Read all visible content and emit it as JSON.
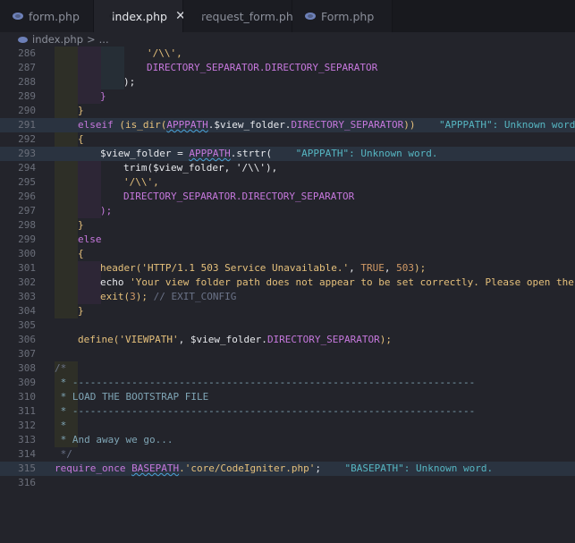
{
  "tabs": [
    {
      "label": "form.php",
      "active": false
    },
    {
      "label": "index.php",
      "active": true
    },
    {
      "label": "request_form.php",
      "active": false
    },
    {
      "label": "Form.php",
      "active": false
    }
  ],
  "close_glyph": "✕",
  "breadcrumb": {
    "file": "index.php",
    "sep": ">",
    "more": "..."
  },
  "lines": [
    {
      "n": "286"
    },
    {
      "n": "287"
    },
    {
      "n": "288"
    },
    {
      "n": "289"
    },
    {
      "n": "290"
    },
    {
      "n": "291"
    },
    {
      "n": "292"
    },
    {
      "n": "293"
    },
    {
      "n": "294"
    },
    {
      "n": "295"
    },
    {
      "n": "296"
    },
    {
      "n": "297"
    },
    {
      "n": "298"
    },
    {
      "n": "299"
    },
    {
      "n": "300"
    },
    {
      "n": "301"
    },
    {
      "n": "302"
    },
    {
      "n": "303"
    },
    {
      "n": "304"
    },
    {
      "n": "305"
    },
    {
      "n": "306"
    },
    {
      "n": "307"
    },
    {
      "n": "308"
    },
    {
      "n": "309"
    },
    {
      "n": "310"
    },
    {
      "n": "311"
    },
    {
      "n": "312"
    },
    {
      "n": "313"
    },
    {
      "n": "314"
    },
    {
      "n": "315"
    },
    {
      "n": "316"
    }
  ],
  "code": {
    "l286": "'/\\\\',",
    "l287": "DIRECTORY_SEPARATOR.DIRECTORY_SEPARATOR",
    "l288": ");",
    "l289": "}",
    "l290": "}",
    "l291_kw": "elseif",
    "l291_a": "(is_dir(",
    "l291_app": "APPPATH",
    "l291_b": ".$view_folder.",
    "l291_ds": "DIRECTORY_SEPARATOR",
    "l291_c": "))",
    "l291_lens": "\"APPPATH\": Unknown word.",
    "l292": "{",
    "l293_a": "$view_folder = ",
    "l293_app": "APPPATH",
    "l293_b": ".strtr(",
    "l293_lens": "\"APPPATH\": Unknown word.",
    "l294": "trim($view_folder, '/\\\\'),",
    "l295": "'/\\\\',",
    "l296": "DIRECTORY_SEPARATOR.DIRECTORY_SEPARATOR",
    "l297": ");",
    "l298": "}",
    "l299": "else",
    "l300": "{",
    "l301_fn": "header(",
    "l301_str": "'HTTP/1.1 503 Service Unavailable.'",
    "l301_c": ", ",
    "l301_true": "TRUE",
    "l301_d": ", ",
    "l301_num": "503",
    "l301_e": ");",
    "l302_kw": "echo ",
    "l302_str": "'Your view folder path does not appear to be set correctly. Please open the fo",
    "l303_fn": "exit(",
    "l303_num": "3",
    "l303_b": "); ",
    "l303_cm": "// EXIT_CONFIG",
    "l304": "}",
    "l306_fn": "define(",
    "l306_str": "'VIEWPATH'",
    "l306_b": ", $view_folder.",
    "l306_ds": "DIRECTORY_SEPARATOR",
    "l306_c": ");",
    "l308": "/*",
    "l309": " * --------------------------------------------------------------------",
    "l310": " * LOAD THE BOOTSTRAP FILE",
    "l311": " * --------------------------------------------------------------------",
    "l312": " *",
    "l313": " * And away we go...",
    "l314": " */",
    "l315_kw": "require_once ",
    "l315_bp": "BASEPATH",
    "l315_str": ".'core/CodeIgniter.php'",
    "l315_b": ";",
    "l315_lens": "\"BASEPATH\": Unknown word."
  }
}
